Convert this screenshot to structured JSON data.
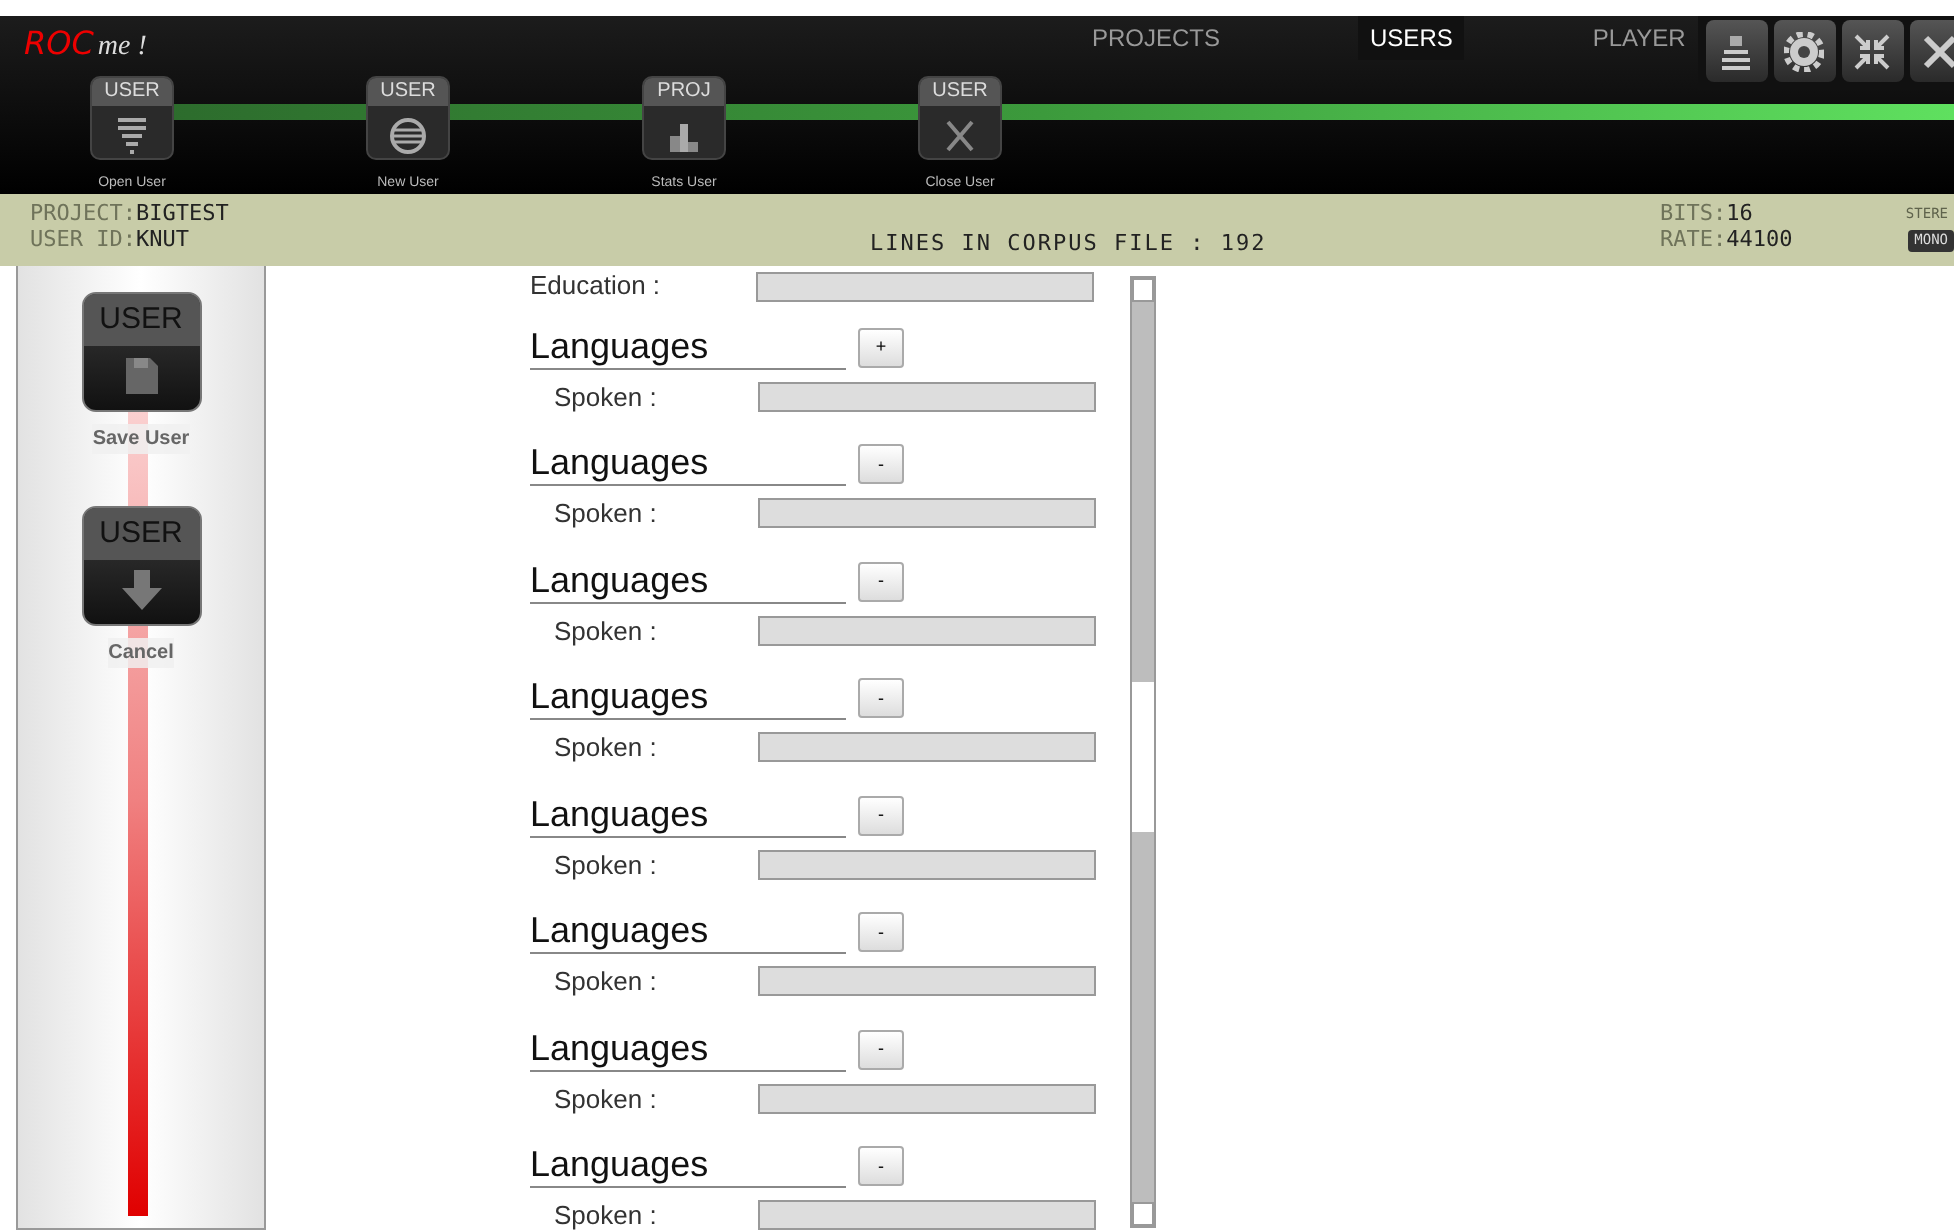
{
  "app": {
    "logo_primary": "ROC",
    "logo_secondary": "me !"
  },
  "tabs": [
    {
      "label": "PROJECTS",
      "selected": false
    },
    {
      "label": "USERS",
      "selected": true
    },
    {
      "label": "PLAYER",
      "selected": false
    }
  ],
  "window_buttons": [
    {
      "kind": "lamp"
    },
    {
      "kind": "settings"
    },
    {
      "kind": "collapse"
    },
    {
      "kind": "close"
    }
  ],
  "toolbar": [
    {
      "badge": "USER",
      "label": "Open User",
      "kind": "open"
    },
    {
      "badge": "USER",
      "label": "New User",
      "kind": "new"
    },
    {
      "badge": "PROJ",
      "label": "Stats User",
      "kind": "stats"
    },
    {
      "badge": "USER",
      "label": "Close User",
      "kind": "close"
    }
  ],
  "info": {
    "project_label": "PROJECT:",
    "project": "BIGTEST",
    "user_label": "USER ID:",
    "user": "KNUT",
    "corpus": "LINES IN CORPUS FILE : 192",
    "bits_label": "BITS:",
    "bits": "16",
    "rate_label": "RATE:",
    "rate": "44100",
    "channel_modes": [
      {
        "label": "STERE",
        "selected": false
      },
      {
        "label": "MONO",
        "selected": true
      }
    ]
  },
  "sidebar": [
    {
      "badge": "USER",
      "label": "Save User",
      "kind": "save"
    },
    {
      "badge": "USER",
      "label": "Cancel",
      "kind": "cancel"
    }
  ],
  "form": {
    "fields": [
      {
        "label": "Education :"
      }
    ],
    "sections": [
      {
        "heading": "Languages",
        "button": "+",
        "field_label": "Spoken :"
      },
      {
        "heading": "Languages",
        "button": "-",
        "field_label": "Spoken :"
      },
      {
        "heading": "Languages",
        "button": "-",
        "field_label": "Spoken :"
      },
      {
        "heading": "Languages",
        "button": "-",
        "field_label": "Spoken :"
      },
      {
        "heading": "Languages",
        "button": "-",
        "field_label": "Spoken :"
      },
      {
        "heading": "Languages",
        "button": "-",
        "field_label": "Spoken :"
      },
      {
        "heading": "Languages",
        "button": "-",
        "field_label": "Spoken :"
      },
      {
        "heading": "Languages",
        "button": "-",
        "field_label": "Spoken :"
      }
    ]
  }
}
